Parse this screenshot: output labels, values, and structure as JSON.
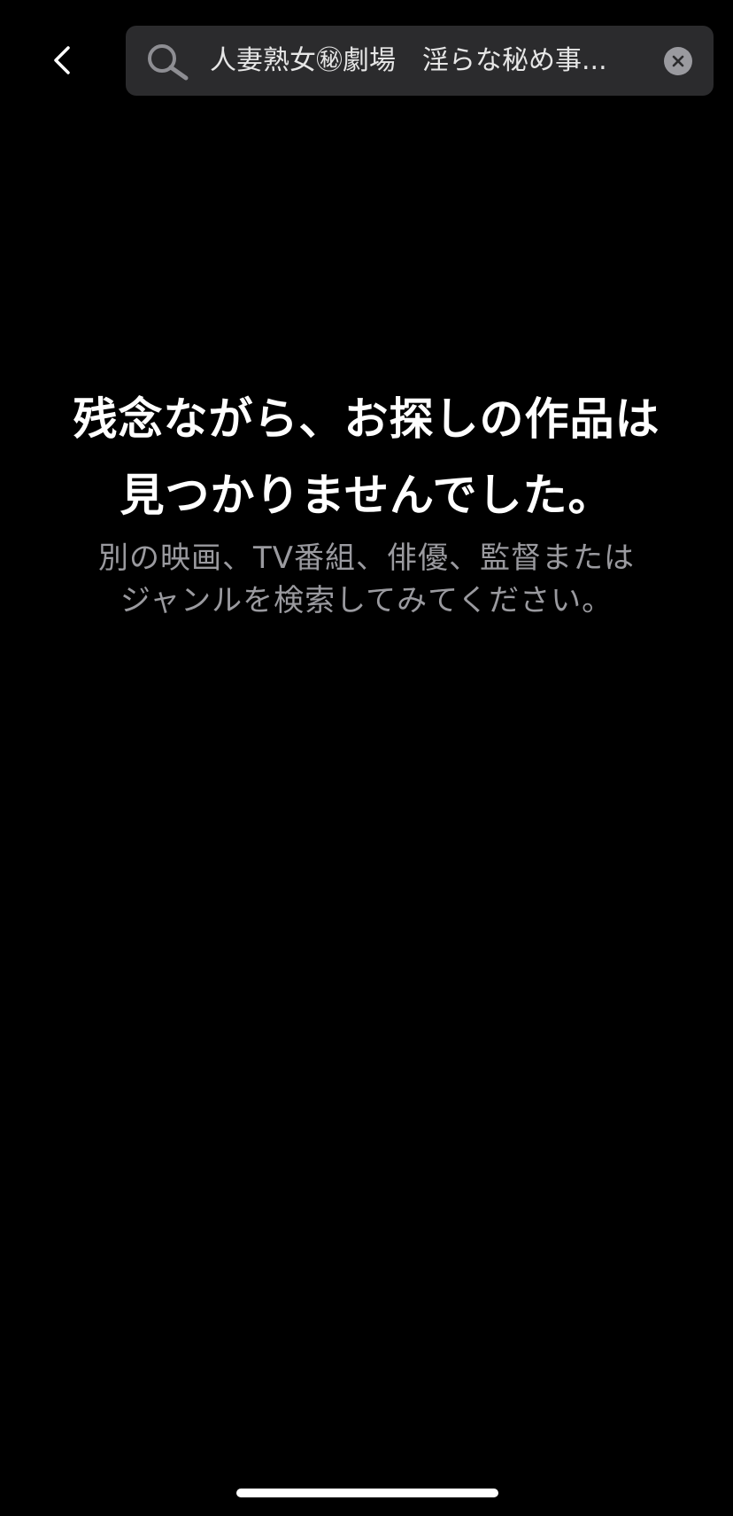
{
  "header": {
    "search": {
      "value": "人妻熟女㊙劇場　淫らな秘め事...",
      "icon": "search-icon",
      "clear_icon": "clear-icon"
    },
    "back_icon": "chevron-left-icon"
  },
  "empty_state": {
    "title_lines": [
      "残念ながら、お探しの作品は",
      "見つかりませんでした。"
    ],
    "subtitle_lines": [
      "別の映画、TV番組、俳優、監督または",
      "ジャンルを検索してみてください。"
    ]
  },
  "colors": {
    "background": "#000000",
    "search_bg": "#2b2b2d",
    "title_text": "#ffffff",
    "subtitle_text": "#9a9a9f"
  }
}
